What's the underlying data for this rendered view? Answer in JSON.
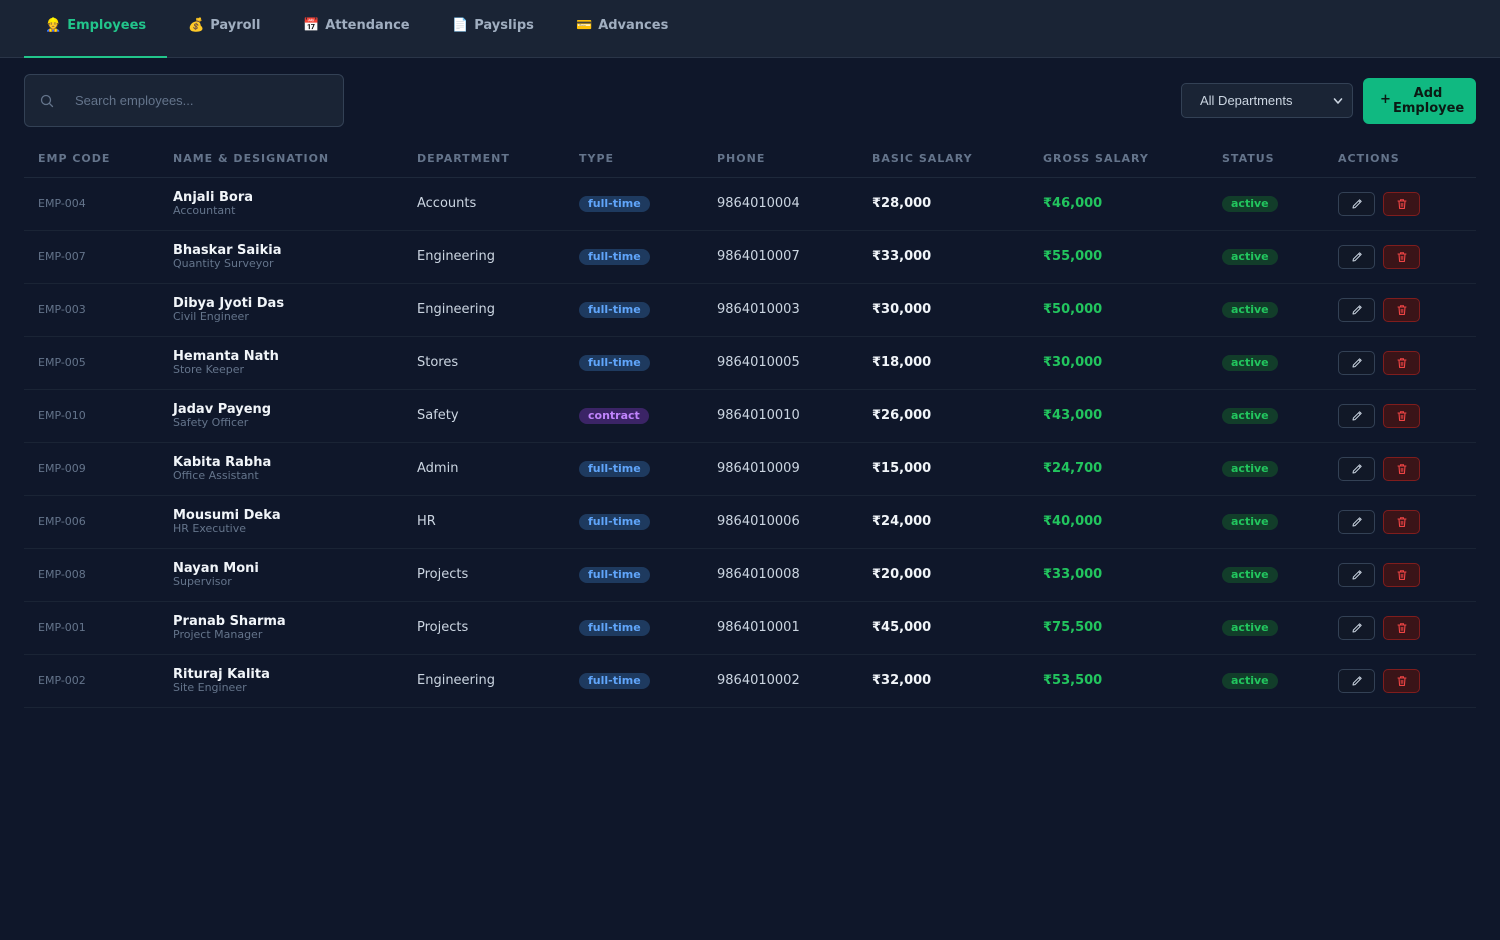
{
  "tabs": [
    {
      "icon": "👷",
      "label": "Employees",
      "active": true
    },
    {
      "icon": "💰",
      "label": "Payroll",
      "active": false
    },
    {
      "icon": "📅",
      "label": "Attendance",
      "active": false
    },
    {
      "icon": "📄",
      "label": "Payslips",
      "active": false
    },
    {
      "icon": "💳",
      "label": "Advances",
      "active": false
    }
  ],
  "search": {
    "placeholder": "Search employees...",
    "icon": "search-icon"
  },
  "department_filter": {
    "selected": "All Departments",
    "icon": "chevron-down-icon"
  },
  "add_button": {
    "plus": "+",
    "label": "Add Employee"
  },
  "table": {
    "headers": {
      "emp_code": "EMP CODE",
      "name": "NAME & DESIGNATION",
      "department": "DEPARTMENT",
      "type": "TYPE",
      "phone": "PHONE",
      "basic": "BASIC SALARY",
      "gross": "GROSS SALARY",
      "status": "STATUS",
      "actions": "ACTIONS"
    },
    "rows": [
      {
        "code": "EMP-004",
        "name": "Anjali Bora",
        "designation": "Accountant",
        "department": "Accounts",
        "type": "full-time",
        "phone": "9864010004",
        "basic": "₹28,000",
        "gross": "₹46,000",
        "status": "active"
      },
      {
        "code": "EMP-007",
        "name": "Bhaskar Saikia",
        "designation": "Quantity Surveyor",
        "department": "Engineering",
        "type": "full-time",
        "phone": "9864010007",
        "basic": "₹33,000",
        "gross": "₹55,000",
        "status": "active"
      },
      {
        "code": "EMP-003",
        "name": "Dibya Jyoti Das",
        "designation": "Civil Engineer",
        "department": "Engineering",
        "type": "full-time",
        "phone": "9864010003",
        "basic": "₹30,000",
        "gross": "₹50,000",
        "status": "active"
      },
      {
        "code": "EMP-005",
        "name": "Hemanta Nath",
        "designation": "Store Keeper",
        "department": "Stores",
        "type": "full-time",
        "phone": "9864010005",
        "basic": "₹18,000",
        "gross": "₹30,000",
        "status": "active"
      },
      {
        "code": "EMP-010",
        "name": "Jadav Payeng",
        "designation": "Safety Officer",
        "department": "Safety",
        "type": "contract",
        "phone": "9864010010",
        "basic": "₹26,000",
        "gross": "₹43,000",
        "status": "active"
      },
      {
        "code": "EMP-009",
        "name": "Kabita Rabha",
        "designation": "Office Assistant",
        "department": "Admin",
        "type": "full-time",
        "phone": "9864010009",
        "basic": "₹15,000",
        "gross": "₹24,700",
        "status": "active"
      },
      {
        "code": "EMP-006",
        "name": "Mousumi Deka",
        "designation": "HR Executive",
        "department": "HR",
        "type": "full-time",
        "phone": "9864010006",
        "basic": "₹24,000",
        "gross": "₹40,000",
        "status": "active"
      },
      {
        "code": "EMP-008",
        "name": "Nayan Moni",
        "designation": "Supervisor",
        "department": "Projects",
        "type": "full-time",
        "phone": "9864010008",
        "basic": "₹20,000",
        "gross": "₹33,000",
        "status": "active"
      },
      {
        "code": "EMP-001",
        "name": "Pranab Sharma",
        "designation": "Project Manager",
        "department": "Projects",
        "type": "full-time",
        "phone": "9864010001",
        "basic": "₹45,000",
        "gross": "₹75,500",
        "status": "active"
      },
      {
        "code": "EMP-002",
        "name": "Rituraj Kalita",
        "designation": "Site Engineer",
        "department": "Engineering",
        "type": "full-time",
        "phone": "9864010002",
        "basic": "₹32,000",
        "gross": "₹53,500",
        "status": "active"
      }
    ],
    "row_action_icons": {
      "edit": "pencil-icon",
      "delete": "trash-icon"
    }
  },
  "colors": {
    "background": "#0f172a",
    "accent": "#10b981",
    "gross_salary": "#22c55e",
    "delete": "#ef4444"
  }
}
